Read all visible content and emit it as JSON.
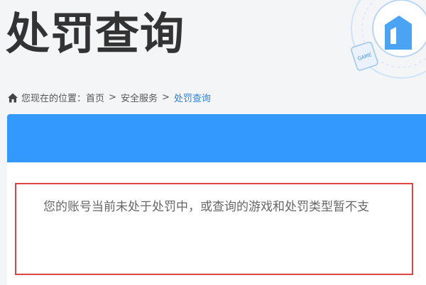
{
  "page": {
    "title": "处罚查询"
  },
  "breadcrumb": {
    "prefix": "您现在的位置：",
    "items": [
      "首页",
      "安全服务",
      "处罚查询"
    ],
    "separator": ">"
  },
  "result": {
    "message": "您的账号当前未处于处罚中，或查询的游戏和处罚类型暂不支"
  },
  "decoration": {
    "badge_text": "GAME"
  },
  "colors": {
    "accent_blue": "#3399ff",
    "link_blue": "#2f7fd6",
    "highlight_red": "#e04545",
    "title_text": "#333333"
  }
}
